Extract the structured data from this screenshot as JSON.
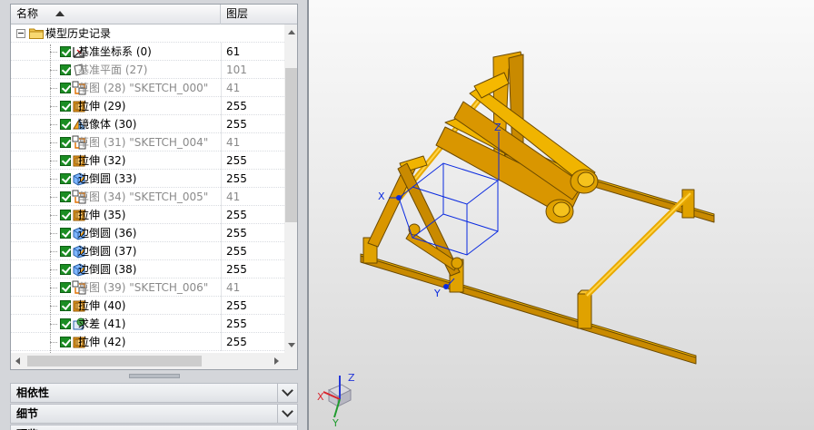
{
  "navigator": {
    "columns": [
      "名称",
      "图层"
    ],
    "root_label": "模型历史记录",
    "items": [
      {
        "label": "基准坐标系 (0)",
        "layer": "61",
        "icon": "datum-csys-icon",
        "dimmed": false
      },
      {
        "label": "基准平面 (27)",
        "layer": "101",
        "icon": "datum-plane-icon",
        "dimmed": true
      },
      {
        "label": "草图 (28) \"SKETCH_000\"",
        "layer": "41",
        "icon": "sketch-icon",
        "dimmed": true
      },
      {
        "label": "拉伸 (29)",
        "layer": "255",
        "icon": "extrude-icon",
        "dimmed": false
      },
      {
        "label": "镜像体 (30)",
        "layer": "255",
        "icon": "mirror-body-icon",
        "dimmed": false
      },
      {
        "label": "草图 (31) \"SKETCH_004\"",
        "layer": "41",
        "icon": "sketch-icon",
        "dimmed": true
      },
      {
        "label": "拉伸 (32)",
        "layer": "255",
        "icon": "extrude-icon",
        "dimmed": false
      },
      {
        "label": "边倒圆 (33)",
        "layer": "255",
        "icon": "edge-blend-icon",
        "dimmed": false
      },
      {
        "label": "草图 (34) \"SKETCH_005\"",
        "layer": "41",
        "icon": "sketch-icon",
        "dimmed": true
      },
      {
        "label": "拉伸 (35)",
        "layer": "255",
        "icon": "extrude-icon",
        "dimmed": false
      },
      {
        "label": "边倒圆 (36)",
        "layer": "255",
        "icon": "edge-blend-icon",
        "dimmed": false
      },
      {
        "label": "边倒圆 (37)",
        "layer": "255",
        "icon": "edge-blend-icon",
        "dimmed": false
      },
      {
        "label": "边倒圆 (38)",
        "layer": "255",
        "icon": "edge-blend-icon",
        "dimmed": false
      },
      {
        "label": "草图 (39) \"SKETCH_006\"",
        "layer": "41",
        "icon": "sketch-icon",
        "dimmed": true
      },
      {
        "label": "拉伸 (40)",
        "layer": "255",
        "icon": "extrude-icon",
        "dimmed": false
      },
      {
        "label": "求差 (41)",
        "layer": "255",
        "icon": "subtract-icon",
        "dimmed": false
      },
      {
        "label": "拉伸 (42)",
        "layer": "255",
        "icon": "extrude-icon",
        "dimmed": false
      }
    ],
    "sections": [
      "相依性",
      "细节",
      "预览"
    ]
  },
  "viewport": {
    "axes": {
      "x": "X",
      "y": "Y",
      "z": "Z"
    },
    "triad": {
      "x": "X",
      "y": "Y",
      "z": "Z"
    }
  },
  "colors": {
    "model": "#f5b800",
    "datum": "#0a2ae0",
    "checkbox": "#1b8d23"
  }
}
